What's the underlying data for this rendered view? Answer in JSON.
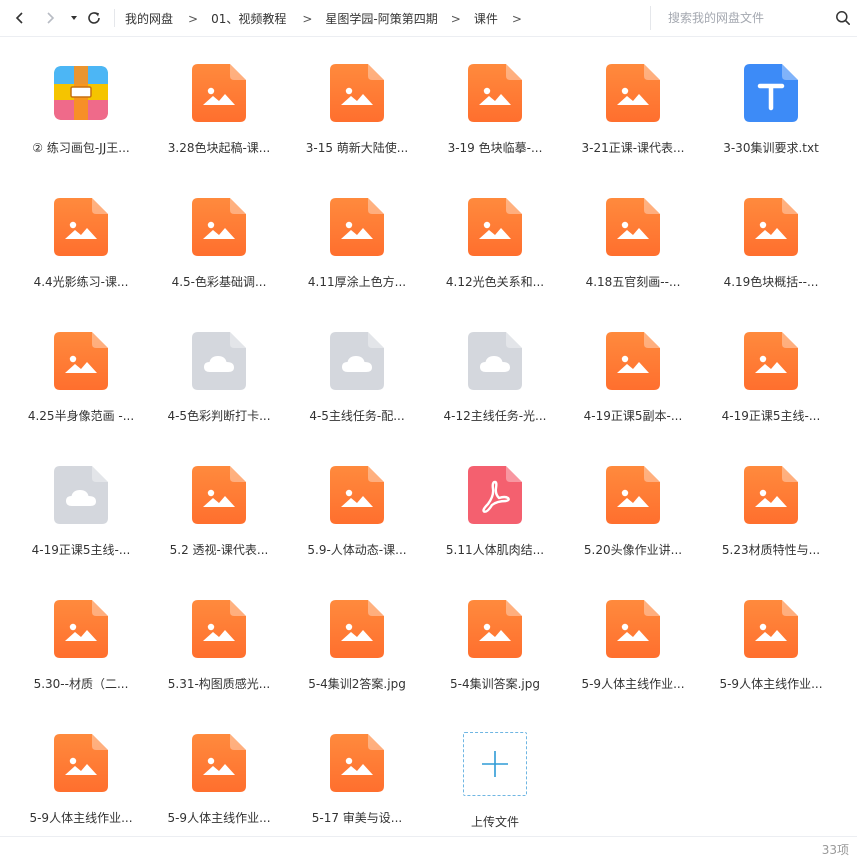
{
  "nav": {
    "breadcrumbs": [
      "我的网盘",
      "01、视频教程",
      "星图学园-阿策第四期",
      "课件"
    ],
    "arrow": ">"
  },
  "search": {
    "placeholder": "搜索我的网盘文件"
  },
  "colors": {
    "image_orange": "#FF8A3D",
    "image_orange_dark": "#FF6F2E",
    "cloud_gray": "#D4D7DD",
    "pdf_red": "#F4606F",
    "txt_blue": "#3D8BF7",
    "upload_blue": "#2E9BD6"
  },
  "files": [
    {
      "name": "② 练习画包-JJ王...",
      "type": "archive-icon"
    },
    {
      "name": "3.28色块起稿-课...",
      "type": "image-icon"
    },
    {
      "name": "3-15 萌新大陆使...",
      "type": "image-icon"
    },
    {
      "name": "3-19 色块临摹-...",
      "type": "image-icon"
    },
    {
      "name": "3-21正课-课代表...",
      "type": "image-icon"
    },
    {
      "name": "3-30集训要求.txt",
      "type": "txt-icon"
    },
    {
      "name": "4.4光影练习-课...",
      "type": "image-icon"
    },
    {
      "name": "4.5-色彩基础调...",
      "type": "image-icon"
    },
    {
      "name": "4.11厚涂上色方...",
      "type": "image-icon"
    },
    {
      "name": "4.12光色关系和...",
      "type": "image-icon"
    },
    {
      "name": "4.18五官刻画--...",
      "type": "image-icon"
    },
    {
      "name": "4.19色块概括--...",
      "type": "image-icon"
    },
    {
      "name": "4.25半身像范画 -...",
      "type": "image-icon"
    },
    {
      "name": "4-5色彩判断打卡...",
      "type": "cloud-icon"
    },
    {
      "name": "4-5主线任务-配...",
      "type": "cloud-icon"
    },
    {
      "name": "4-12主线任务-光...",
      "type": "cloud-icon"
    },
    {
      "name": "4-19正课5副本-...",
      "type": "image-icon"
    },
    {
      "name": "4-19正课5主线-...",
      "type": "image-icon"
    },
    {
      "name": "4-19正课5主线-...",
      "type": "cloud-icon"
    },
    {
      "name": "5.2 透视-课代表...",
      "type": "image-icon"
    },
    {
      "name": "5.9-人体动态-课...",
      "type": "image-icon"
    },
    {
      "name": "5.11人体肌肉结...",
      "type": "pdf-icon"
    },
    {
      "name": "5.20头像作业讲...",
      "type": "image-icon"
    },
    {
      "name": "5.23材质特性与...",
      "type": "image-icon"
    },
    {
      "name": "5.30--材质（二...",
      "type": "image-icon"
    },
    {
      "name": "5.31-构图质感光...",
      "type": "image-icon"
    },
    {
      "name": "5-4集训2答案.jpg",
      "type": "image-icon"
    },
    {
      "name": "5-4集训答案.jpg",
      "type": "image-icon"
    },
    {
      "name": "5-9人体主线作业...",
      "type": "image-icon"
    },
    {
      "name": "5-9人体主线作业...",
      "type": "image-icon"
    },
    {
      "name": "5-9人体主线作业...",
      "type": "image-icon"
    },
    {
      "name": "5-9人体主线作业...",
      "type": "image-icon"
    },
    {
      "name": "5-17  审美与设...",
      "type": "image-icon"
    }
  ],
  "upload": {
    "label": "上传文件"
  },
  "status": {
    "count": "33项"
  }
}
